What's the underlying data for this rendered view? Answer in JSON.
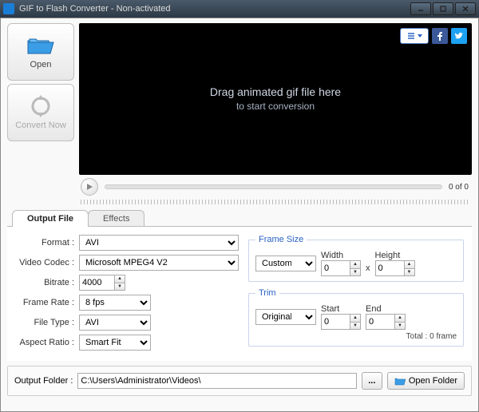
{
  "window": {
    "title": "GIF to Flash Converter - Non-activated"
  },
  "sidebar": {
    "open_label": "Open",
    "convert_label": "Convert Now"
  },
  "preview": {
    "line1": "Drag animated gif file here",
    "line2": "to start conversion",
    "counter": "0 of 0"
  },
  "tabs": {
    "output": "Output File",
    "effects": "Effects"
  },
  "settings": {
    "format_label": "Format :",
    "format_value": "AVI",
    "codec_label": "Video Codec :",
    "codec_value": "Microsoft MPEG4 V2",
    "bitrate_label": "Bitrate :",
    "bitrate_value": "4000",
    "framerate_label": "Frame Rate :",
    "framerate_value": "8 fps",
    "filetype_label": "File Type :",
    "filetype_value": "AVI",
    "aspect_label": "Aspect Ratio :",
    "aspect_value": "Smart Fit"
  },
  "framesize": {
    "legend": "Frame Size",
    "mode": "Custom",
    "width_label": "Width",
    "width_value": "0",
    "cross": "x",
    "height_label": "Height",
    "height_value": "0"
  },
  "trim": {
    "legend": "Trim",
    "mode": "Original",
    "start_label": "Start",
    "start_value": "0",
    "end_label": "End",
    "end_value": "0",
    "total": "Total : 0 frame"
  },
  "output": {
    "folder_label": "Output Folder :",
    "folder_path": "C:\\Users\\Administrator\\Videos\\",
    "browse": "...",
    "open_folder": "Open Folder"
  }
}
